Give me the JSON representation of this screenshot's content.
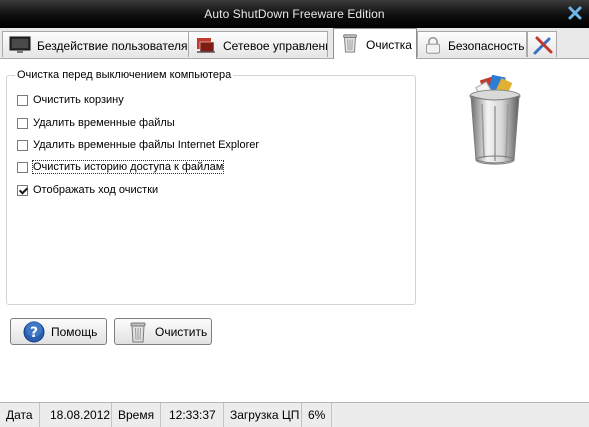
{
  "window": {
    "title": "Auto ShutDown Freeware Edition"
  },
  "tabs": [
    {
      "label": "Бездействие пользователя",
      "active": false
    },
    {
      "label": "Сетевое управление",
      "active": false
    },
    {
      "label": "Очистка",
      "active": true
    },
    {
      "label": "Безопасность",
      "active": false
    }
  ],
  "cleanup": {
    "group_title": "Очистка перед выключением компьютера",
    "options": [
      {
        "label": "Очистить корзину",
        "checked": false
      },
      {
        "label": "Удалить временные файлы",
        "checked": false
      },
      {
        "label": "Удалить временные файлы Internet Explorer",
        "checked": false
      },
      {
        "label": "Очистить историю доступа к файлам",
        "checked": false
      },
      {
        "label": "Отображать ход очистки",
        "checked": true
      }
    ]
  },
  "buttons": {
    "help": "Помощь",
    "clean": "Очистить"
  },
  "status": {
    "date_label": "Дата",
    "date_value": "18.08.2012",
    "time_label": "Время",
    "time_value": "12:33:37",
    "cpu_label": "Загрузка ЦП",
    "cpu_value": "6%"
  },
  "colors": {
    "titlebar": "#000000",
    "help_icon": "#2a5fb0",
    "checkmark": "#1a1a1a"
  }
}
